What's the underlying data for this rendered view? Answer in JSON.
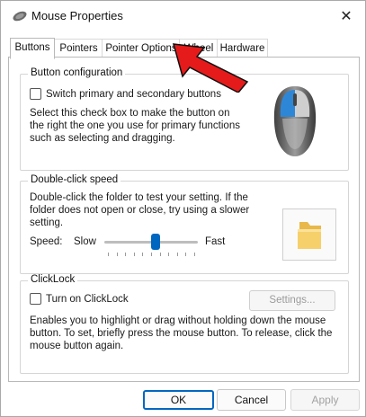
{
  "window": {
    "title": "Mouse Properties",
    "close_glyph": "✕"
  },
  "tabs": [
    {
      "label": "Buttons",
      "active": true
    },
    {
      "label": "Pointers",
      "active": false
    },
    {
      "label": "Pointer Options",
      "active": false
    },
    {
      "label": "Wheel",
      "active": false
    },
    {
      "label": "Hardware",
      "active": false
    }
  ],
  "button_config": {
    "title": "Button configuration",
    "checkbox_label": "Switch primary and secondary buttons",
    "checked": false,
    "description": "Select this check box to make the button on the right the one you use for primary functions such as selecting and dragging."
  },
  "double_click": {
    "title": "Double-click speed",
    "description": "Double-click the folder to test your setting. If the folder does not open or close, try using a slower setting.",
    "speed_label": "Speed:",
    "slow_label": "Slow",
    "fast_label": "Fast",
    "slider_level": 0.55
  },
  "clicklock": {
    "title": "ClickLock",
    "checkbox_label": "Turn on ClickLock",
    "checked": false,
    "settings_label": "Settings...",
    "description": "Enables you to highlight or drag without holding down the mouse button. To set, briefly press the mouse button. To release, click the mouse button again."
  },
  "footer": {
    "ok_label": "OK",
    "cancel_label": "Cancel",
    "apply_label": "Apply"
  },
  "colors": {
    "accent": "#0067c0",
    "arrow_red": "#e51b1b",
    "folder_yellow": "#f5d06b"
  },
  "icons": {
    "title_icon": "mouse-icon",
    "folder_icon": "folder-icon",
    "mouse_image": "mouse-illustration"
  }
}
